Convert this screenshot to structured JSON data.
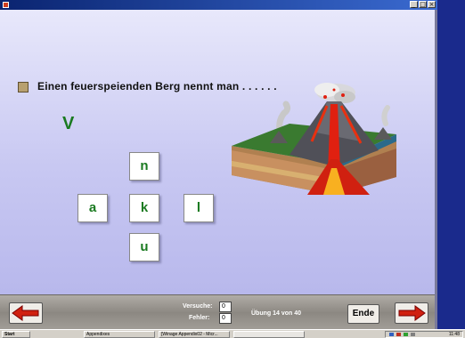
{
  "window": {
    "title": ""
  },
  "exercise": {
    "question": "Einen feuerspeienden Berg nennt man . . . . . .",
    "answer_so_far": "V",
    "letters": [
      "n",
      "a",
      "k",
      "l",
      "u"
    ]
  },
  "footer": {
    "attempts_label": "Versuche:",
    "attempts_value": "0",
    "errors_label": "Fehler:",
    "errors_value": "0",
    "progress": "Übung 14 von 40",
    "end_label": "Ende",
    "prev_icon": "left-arrow-icon",
    "next_icon": "right-arrow-icon"
  },
  "taskbar": {
    "start_label": "Start",
    "items": [
      "Appendixes",
      "[Winage Appendix02 - Micr...",
      ""
    ],
    "clock": "11:48"
  },
  "colors": {
    "accent_green": "#1a7a20",
    "arrow_red": "#d02010",
    "background_lavender": "#c8c8f2"
  }
}
